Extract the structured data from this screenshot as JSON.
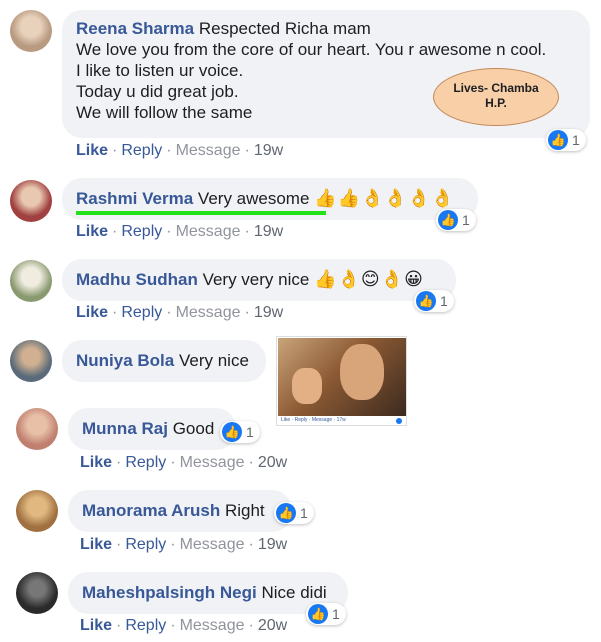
{
  "comments": [
    {
      "name": "Reena Sharma",
      "lines": [
        "Respected Richa mam",
        "We love you from the core of our heart. You r awesome n cool.",
        "I like to listen ur voice.",
        "Today u did great job.",
        "We will follow the same"
      ],
      "like": "Like",
      "reply": "Reply",
      "message": "Message",
      "time": "19w",
      "reaction_count": "1",
      "avatar_color": "#b89a80"
    },
    {
      "name": "Rashmi Verma",
      "text": "Very awesome",
      "emojis": "👍👍👌👌👌👌",
      "like": "Like",
      "reply": "Reply",
      "message": "Message",
      "time": "19w",
      "reaction_count": "1",
      "avatar_color": "#a04040"
    },
    {
      "name": "Madhu Sudhan",
      "text": "Very very nice",
      "emojis": "👍👌😊👌😀",
      "like": "Like",
      "reply": "Reply",
      "message": "Message",
      "time": "19w",
      "reaction_count": "1",
      "avatar_color": "#8a9a70"
    },
    {
      "name": "Nuniya Bola",
      "text": "Very nice",
      "gif_caption": "Like · Reply · Message · 17w",
      "avatar_color": "#5a6a7a"
    },
    {
      "name": "Munna Raj",
      "text": "Good",
      "like": "Like",
      "reply": "Reply",
      "message": "Message",
      "time": "20w",
      "reaction_count": "1",
      "avatar_color": "#c08070"
    },
    {
      "name": "Manorama Arush",
      "text": "Right",
      "like": "Like",
      "reply": "Reply",
      "message": "Message",
      "time": "19w",
      "reaction_count": "1",
      "avatar_color": "#a07040"
    },
    {
      "name": "Maheshpalsingh Negi",
      "text": "Nice didi",
      "like": "Like",
      "reply": "Reply",
      "message": "Message",
      "time": "20w",
      "reaction_count": "1",
      "avatar_color": "#2a2a2a"
    }
  ],
  "annotation": {
    "line1": "Lives- Chamba",
    "line2": "H.P."
  },
  "colors": {
    "name_blue": "#385898",
    "bubble_bg": "#f0f2f5",
    "like_blue": "#1877f2",
    "highlight_green": "#22e01a",
    "oval_fill": "#f9cfa7"
  },
  "icons": {
    "reaction": "thumbs-up-icon"
  }
}
